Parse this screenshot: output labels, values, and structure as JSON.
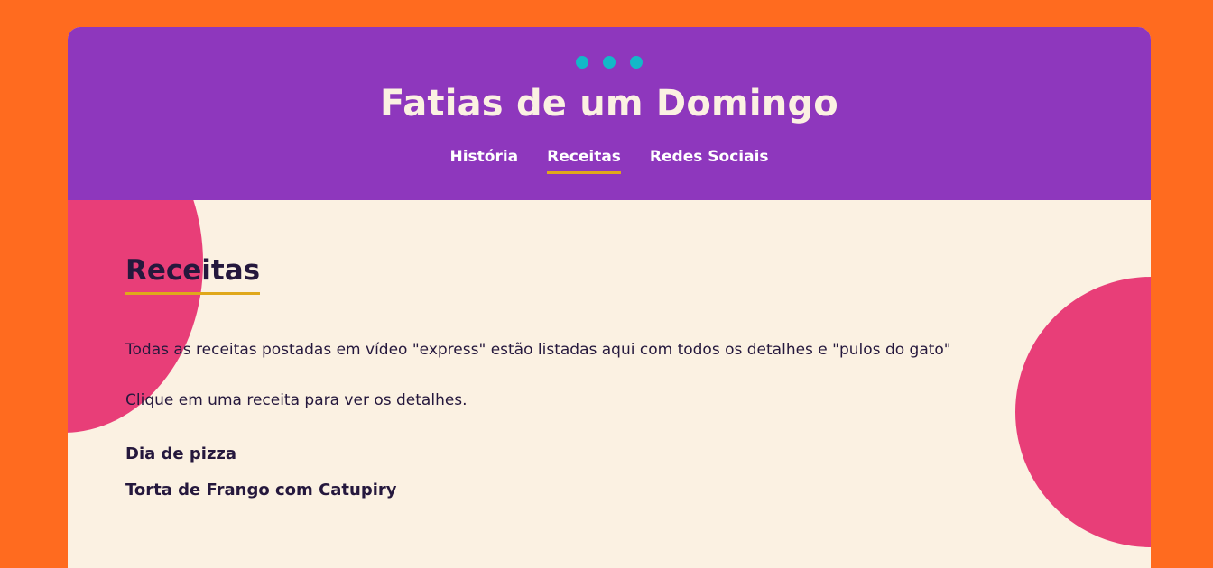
{
  "header": {
    "title": "Fatias de um Domingo",
    "nav": [
      {
        "label": "História",
        "active": false
      },
      {
        "label": "Receitas",
        "active": true
      },
      {
        "label": "Redes Sociais",
        "active": false
      }
    ]
  },
  "main": {
    "title": "Receitas",
    "description": "Todas as receitas postadas em vídeo \"express\" estão listadas aqui com todos os detalhes e \"pulos do gato\"",
    "hint": "Clique em uma receita para ver os detalhes.",
    "recipes": [
      {
        "label": "Dia de pizza"
      },
      {
        "label": "Torta de Frango com Catupiry"
      }
    ]
  },
  "colors": {
    "page_background": "#FF6B1F",
    "header_background": "#8E37BD",
    "content_background": "#FBF1E2",
    "accent_pink": "#E83E78",
    "accent_gold": "#E0A81B",
    "dot_teal": "#13B8C8",
    "text_dark": "#25183D"
  }
}
